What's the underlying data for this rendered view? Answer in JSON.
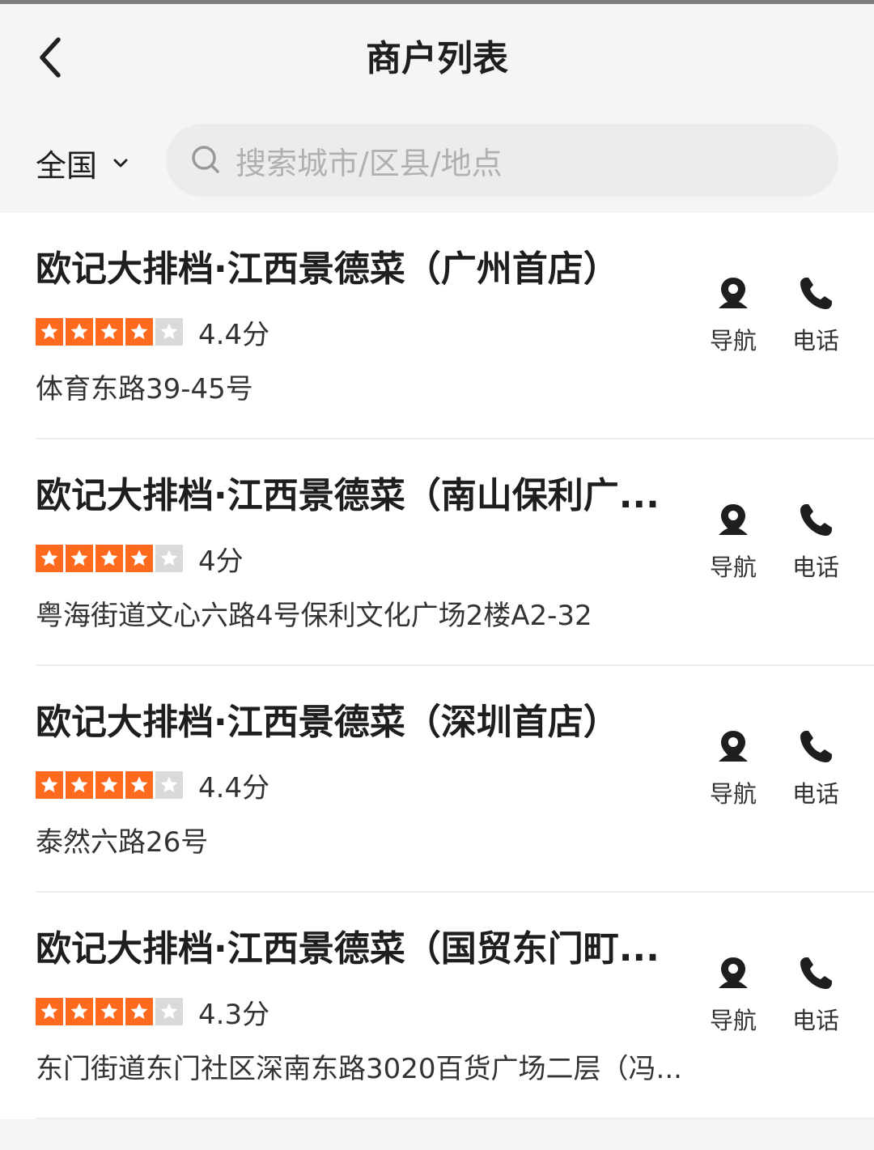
{
  "header": {
    "title": "商户列表",
    "region": "全国",
    "search_placeholder": "搜索城市/区县/地点"
  },
  "colors": {
    "accent": "#ff6a1e",
    "star_off": "#dadada",
    "background": "#f5f5f5"
  },
  "actions": {
    "nav_label": "导航",
    "call_label": "电话"
  },
  "merchants": [
    {
      "name": "欧记大排档·江西景德菜（广州首店）",
      "stars_filled": 4,
      "stars_total": 5,
      "score": "4.4分",
      "address": "体育东路39-45号"
    },
    {
      "name": "欧记大排档·江西景德菜（南山保利广...",
      "stars_filled": 4,
      "stars_total": 5,
      "score": "4分",
      "address": "粤海街道文心六路4号保利文化广场2楼A2-32"
    },
    {
      "name": "欧记大排档·江西景德菜（深圳首店）",
      "stars_filled": 4,
      "stars_total": 5,
      "score": "4.4分",
      "address": "泰然六路26号"
    },
    {
      "name": "欧记大排档·江西景德菜（国贸东门町...",
      "stars_filled": 4,
      "stars_total": 5,
      "score": "4.3分",
      "address": "东门街道东门社区深南东路3020百货广场二层（冯..."
    }
  ]
}
